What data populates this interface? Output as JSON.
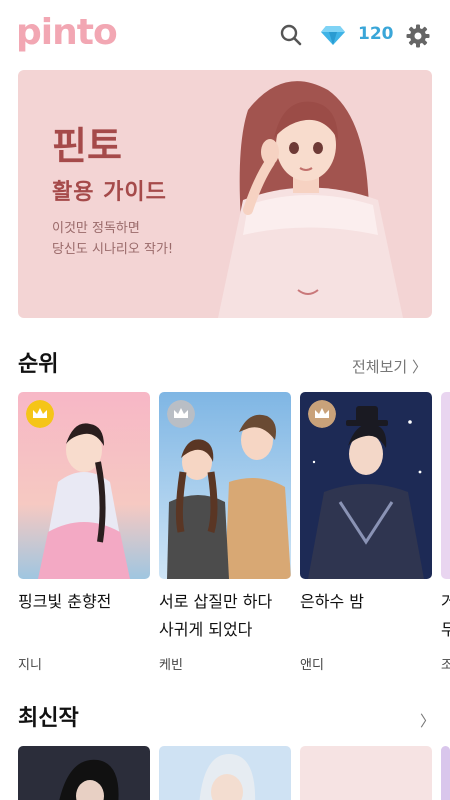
{
  "header": {
    "logo": "pinto",
    "gem_count": "120",
    "icons": [
      "search-icon",
      "diamond-icon",
      "gear-icon"
    ],
    "colors": {
      "logo": "#f2a7b3",
      "gem": "#3aa6d8"
    }
  },
  "banner": {
    "title": "핀토",
    "subtitle": "활용 가이드",
    "line1": "이것만 정독하면",
    "line2": "당신도 시나리오 작가!"
  },
  "ranking": {
    "title": "순위",
    "more": "전체보기 〉",
    "cards": [
      {
        "title": "핑크빛 춘향전",
        "title2": "",
        "author": "지니",
        "badge": "gold"
      },
      {
        "title": "서로 삽질만 하다",
        "title2": "사귀게 되었다",
        "author": "케빈",
        "badge": "silver"
      },
      {
        "title": "은하수 밤",
        "title2": "",
        "author": "앤디",
        "badge": "bronze"
      }
    ],
    "partial": {
      "t1": "거",
      "t2": "두",
      "t3": "조"
    }
  },
  "latest": {
    "title": "최신작",
    "more": "〉"
  }
}
